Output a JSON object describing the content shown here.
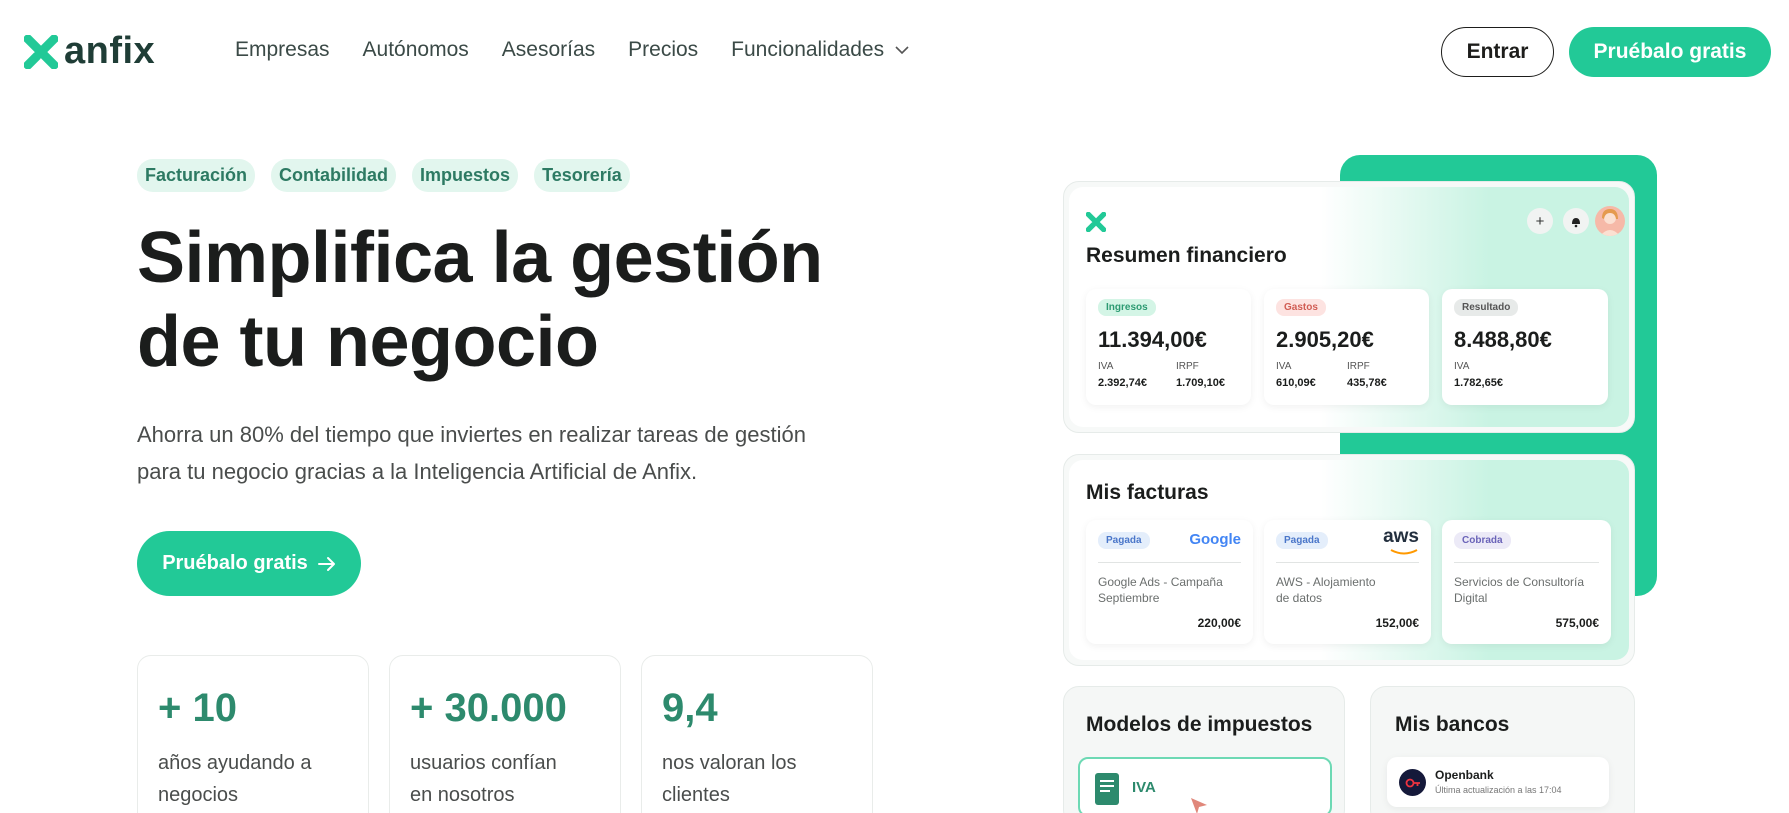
{
  "brand": {
    "name": "anfix",
    "accent": "#22c997",
    "dark": "#1f3d36"
  },
  "nav": {
    "items": [
      {
        "label": "Empresas"
      },
      {
        "label": "Autónomos"
      },
      {
        "label": "Asesorías"
      },
      {
        "label": "Precios"
      },
      {
        "label": "Funcionalidades",
        "icon": "chevron-down-icon"
      }
    ],
    "login_label": "Entrar",
    "cta_label": "Pruébalo gratis"
  },
  "hero": {
    "tags": [
      "Facturación",
      "Contabilidad",
      "Impuestos",
      "Tesorería"
    ],
    "headline_line1": "Simplifica la gestión",
    "headline_line2": "de tu negocio",
    "subtitle_line1": "Ahorra un 80% del tiempo que inviertes en realizar tareas de gestión",
    "subtitle_line2": "para tu negocio gracias a la Inteligencia Artificial de Anfix.",
    "cta_label": "Pruébalo gratis",
    "cta_icon": "arrow-right-icon"
  },
  "stats": [
    {
      "value": "+ 10",
      "label": "años ayudando a negocios"
    },
    {
      "value": "+ 30.000",
      "label": "usuarios confían en nosotros"
    },
    {
      "value": "9,4",
      "label": "nos valoran los clientes"
    }
  ],
  "dashboard": {
    "summary": {
      "title": "Resumen financiero",
      "cards": [
        {
          "tag": "Ingresos",
          "amount": "11.394,00€",
          "l1": "IVA",
          "v1": "2.392,74€",
          "l2": "IRPF",
          "v2": "1.709,10€"
        },
        {
          "tag": "Gastos",
          "amount": "2.905,20€",
          "l1": "IVA",
          "v1": "610,09€",
          "l2": "IRPF",
          "v2": "435,78€"
        },
        {
          "tag": "Resultado",
          "amount": "8.488,80€",
          "l1": "IVA",
          "v1": "1.782,65€"
        }
      ]
    },
    "invoices": {
      "title": "Mis facturas",
      "cards": [
        {
          "status": "Pagada",
          "brand": "Google",
          "desc1": "Google Ads - Campaña",
          "desc2": "Septiembre",
          "amount": "220,00€"
        },
        {
          "status": "Pagada",
          "brand": "aws",
          "desc1": "AWS - Alojamiento",
          "desc2": "de datos",
          "amount": "152,00€"
        },
        {
          "status": "Cobrada",
          "brand": "",
          "desc1": "Servicios de Consultoría",
          "desc2": "Digital",
          "amount": "575,00€"
        }
      ]
    },
    "taxes": {
      "title": "Modelos de impuestos",
      "item": "IVA"
    },
    "banks": {
      "title": "Mis bancos",
      "bank_name": "Openbank",
      "bank_sub": "Última actualización a las 17:04"
    }
  }
}
